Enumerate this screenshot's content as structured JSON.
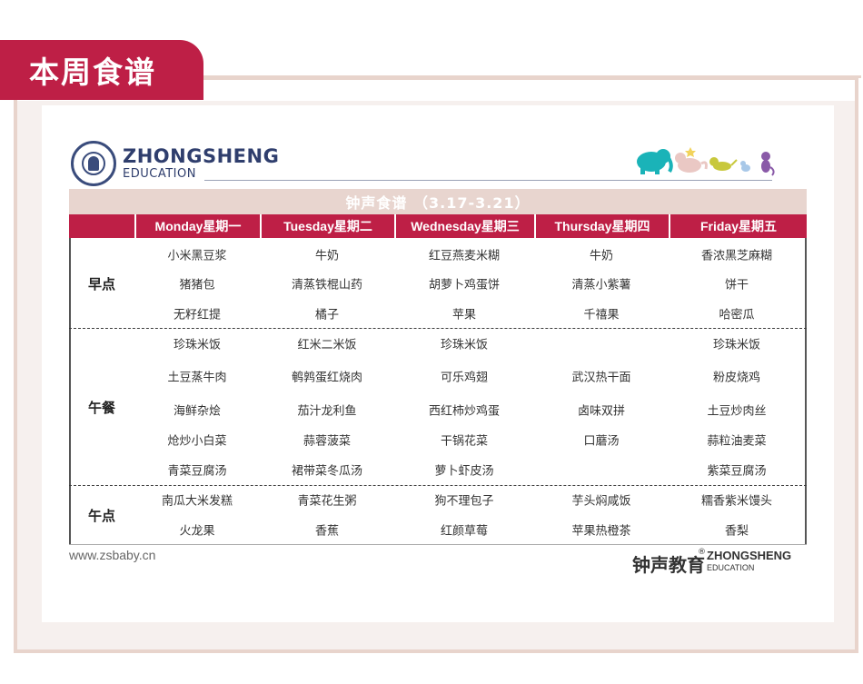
{
  "page_title": "本周食谱",
  "brand": {
    "name": "ZHONGSHENG",
    "sub": "EDUCATION"
  },
  "menu_title": "钟声食谱 （3.17-3.21）",
  "days": [
    "Monday星期一",
    "Tuesday星期二",
    "Wednesday星期三",
    "Thursday星期四",
    "Friday星期五"
  ],
  "meals": [
    {
      "name": "早点",
      "rows": [
        [
          "小米黑豆浆",
          "牛奶",
          "红豆燕麦米糊",
          "牛奶",
          "香浓黑芝麻糊"
        ],
        [
          "猪猪包",
          "清蒸铁棍山药",
          "胡萝卜鸡蛋饼",
          "清蒸小紫薯",
          "饼干"
        ],
        [
          "无籽红提",
          "橘子",
          "苹果",
          "千禧果",
          "哈密瓜"
        ]
      ]
    },
    {
      "name": "午餐",
      "rows": [
        [
          "珍珠米饭",
          "红米二米饭",
          "珍珠米饭",
          "",
          "珍珠米饭"
        ],
        [
          "土豆蒸牛肉",
          "鹌鹑蛋红烧肉",
          "可乐鸡翅",
          "武汉热干面",
          "粉皮烧鸡"
        ],
        [
          "海鲜杂烩",
          "茄汁龙利鱼",
          "西红柿炒鸡蛋",
          "卤味双拼",
          "土豆炒肉丝"
        ],
        [
          "炝炒小白菜",
          "蒜蓉菠菜",
          "干锅花菜",
          "口蘑汤",
          "蒜粒油麦菜"
        ],
        [
          "青菜豆腐汤",
          "裙带菜冬瓜汤",
          "萝卜虾皮汤",
          "",
          "紫菜豆腐汤"
        ]
      ]
    },
    {
      "name": "午点",
      "rows": [
        [
          "南瓜大米发糕",
          "青菜花生粥",
          "狗不理包子",
          "芋头焖咸饭",
          "糯香紫米馒头"
        ],
        [
          "火龙果",
          "香蕉",
          "红颜草莓",
          "苹果热橙茶",
          "香梨"
        ]
      ]
    }
  ],
  "footer": {
    "url": "www.zsbaby.cn",
    "brand_cn": "钟声教育",
    "reg": "®",
    "brand_en": "ZHONGSHENG",
    "brand_en_sub": "EDUCATION"
  },
  "icons": [
    "seal-logo-icon",
    "animal-parade-icon"
  ],
  "colors": {
    "accent": "#be1f46",
    "frame": "#e8d4cc",
    "brand": "#2f3e6d"
  }
}
